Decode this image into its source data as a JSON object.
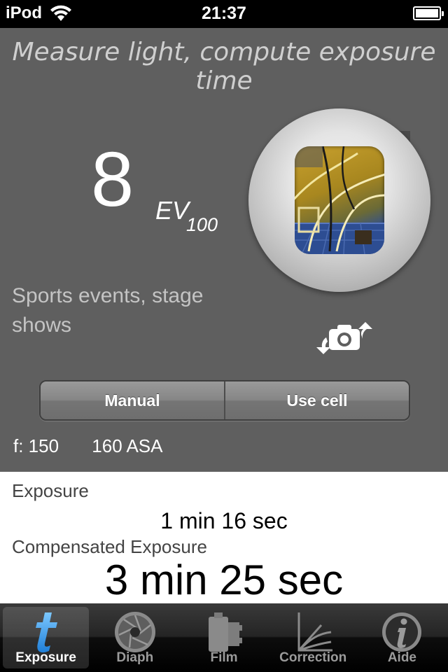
{
  "status_bar": {
    "carrier": "iPod",
    "time": "21:37"
  },
  "main": {
    "headline": "Measure light, compute exposure time",
    "ev": {
      "value": "8",
      "unit": "EV",
      "subscript": "100"
    },
    "scene_description": "Sports events, stage shows",
    "mode": {
      "options": [
        "Manual",
        "Use cell"
      ]
    },
    "settings": {
      "aperture": "f: 150",
      "iso": "160 ASA"
    }
  },
  "results": {
    "exposure_label": "Exposure",
    "exposure_value": "1 min 16 sec",
    "compensated_label": "Compensated Exposure",
    "compensated_value": "3 min 25 sec"
  },
  "tabs": [
    {
      "label": "Exposure",
      "icon": "exposure-t-icon",
      "active": true
    },
    {
      "label": "Diaph",
      "icon": "aperture-icon",
      "active": false
    },
    {
      "label": "Film",
      "icon": "film-icon",
      "active": false
    },
    {
      "label": "Correction",
      "icon": "correction-graph-icon",
      "active": false
    },
    {
      "label": "Aide",
      "icon": "info-icon",
      "active": false
    }
  ],
  "colors": {
    "panel": "#5f5f5f",
    "active_tab_icon": "#3aa0ee"
  }
}
